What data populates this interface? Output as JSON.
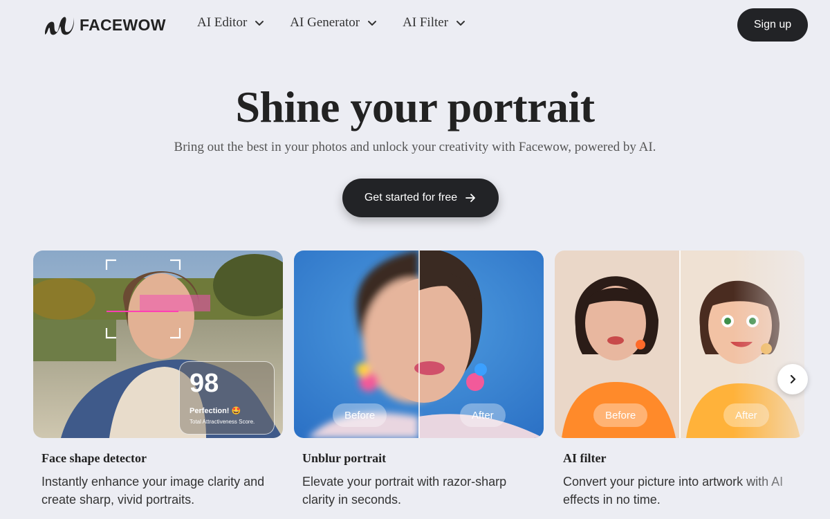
{
  "brand": {
    "name": "FACEWOW"
  },
  "nav": {
    "items": [
      {
        "label": "AI Editor"
      },
      {
        "label": "AI Generator"
      },
      {
        "label": "AI Filter"
      }
    ],
    "signup_label": "Sign up"
  },
  "hero": {
    "title": "Shine your portrait",
    "subtitle": "Bring out the best in your photos and unlock your creativity with Facewow, powered by AI.",
    "cta_label": "Get started for free"
  },
  "cards": [
    {
      "title": "Face shape detector",
      "description": "Instantly enhance your image clarity and create sharp, vivid portraits.",
      "score": "98",
      "score_label": "Perfection! 🤩",
      "score_caption": "Total Attractiveness Score."
    },
    {
      "title": "Unblur portrait",
      "description": "Elevate your portrait with razor-sharp clarity in seconds.",
      "before_label": "Before",
      "after_label": "After"
    },
    {
      "title": "AI filter",
      "description": "Convert your picture into artwork with AI effects in no time.",
      "before_label": "Before",
      "after_label": "After"
    }
  ],
  "colors": {
    "background": "#ecedf3",
    "dark_button": "#222326"
  },
  "icons": {
    "nav_chevron": "chevron-down-icon",
    "cta_arrow": "arrow-right-icon",
    "carousel_next": "chevron-right-icon"
  }
}
